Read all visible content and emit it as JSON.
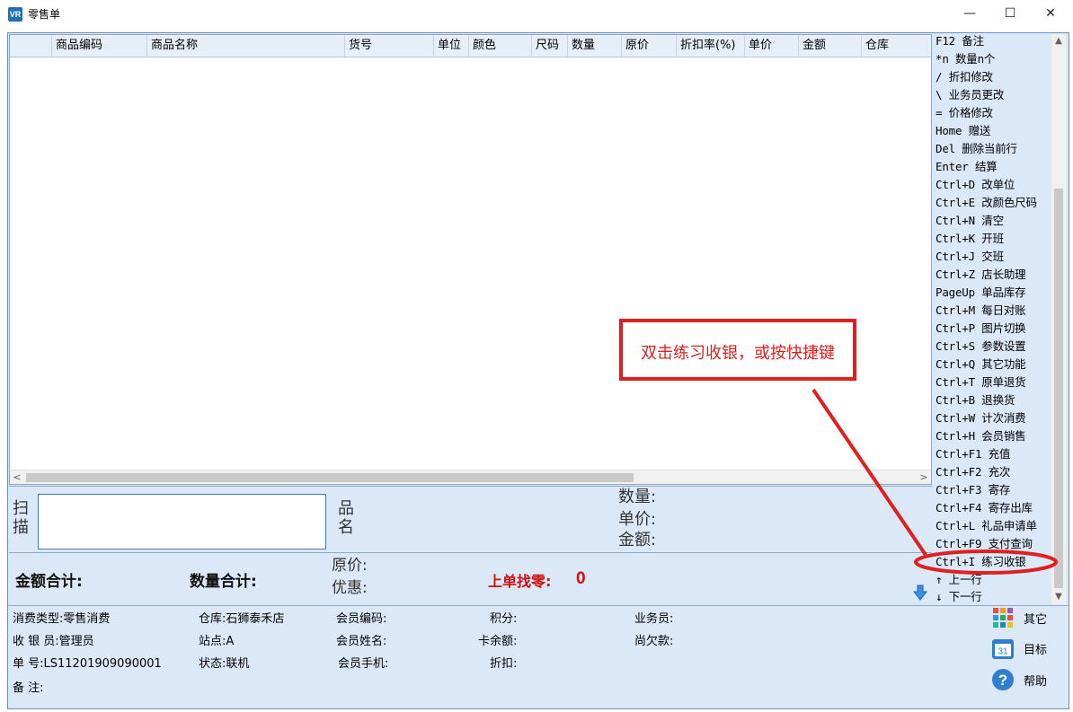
{
  "window": {
    "title": "零售单",
    "app_icon": "VR",
    "min_glyph": "—",
    "max_glyph": "☐",
    "close_glyph": "✕"
  },
  "grid": {
    "columns": [
      "",
      "商品编码",
      "商品名称",
      "货号",
      "单位",
      "颜色",
      "尺码",
      "数量",
      "原价",
      "折扣率(%)",
      "单价",
      "金额",
      "仓库"
    ],
    "scroll_left": "<",
    "scroll_right": ">"
  },
  "shortcuts": [
    "F12 备注",
    "*n  数量n个",
    "/ 折扣修改",
    "\\ 业务员更改",
    "= 价格修改",
    "Home 赠送",
    "Del 删除当前行",
    "Enter 结算",
    "Ctrl+D 改单位",
    "Ctrl+E 改颜色尺码",
    "Ctrl+N 清空",
    "Ctrl+K 开班",
    "Ctrl+J 交班",
    "Ctrl+Z 店长助理",
    "PageUp 单品库存",
    "Ctrl+M 每日对账",
    "Ctrl+P 图片切换",
    "Ctrl+S 参数设置",
    "Ctrl+Q 其它功能",
    "Ctrl+T 原单退货",
    "Ctrl+B 退换货",
    "Ctrl+W 计次消费",
    "Ctrl+H 会员销售",
    "Ctrl+F1 充值",
    "Ctrl+F2 充次",
    "Ctrl+F3 寄存",
    "Ctrl+F4 寄存出库",
    "Ctrl+L 礼品申请单",
    "Ctrl+F9 支付查询",
    "Ctrl+I 练习收银",
    "↑ 上一行",
    "↓ 下一行"
  ],
  "scan": {
    "scan_label": "扫描",
    "name_label": "品名",
    "qty_label": "数量:",
    "price_label": "单价:",
    "amount_label": "金额:"
  },
  "totals": {
    "amount_total_label": "金额合计:",
    "qty_total_label": "数量合计:",
    "orig_price_label": "原价:",
    "discount_label": "优惠:",
    "change_label": "上单找零:",
    "change_value": "0"
  },
  "info": {
    "consume_type": "消费类型:零售消费",
    "warehouse": "仓库:石狮泰禾店",
    "member_code": "会员编码:",
    "points": "积分:",
    "salesperson": "业务员:",
    "cashier": "收 银 员:管理员",
    "station": "站点:A",
    "member_name": "会员姓名:",
    "card_balance": "卡余额:",
    "arrears": "尚欠款:",
    "order_no": "单      号:LS11201909090001",
    "status": "状态:联机",
    "member_phone": "会员手机:",
    "discount": "折扣:",
    "remark": "备      注:"
  },
  "side_buttons": {
    "other": "其它",
    "target": "目标",
    "help": "帮助",
    "calendar_num": "31"
  },
  "annotation": {
    "text": "双击练习收银，或按快捷键",
    "color": "#e02020"
  }
}
